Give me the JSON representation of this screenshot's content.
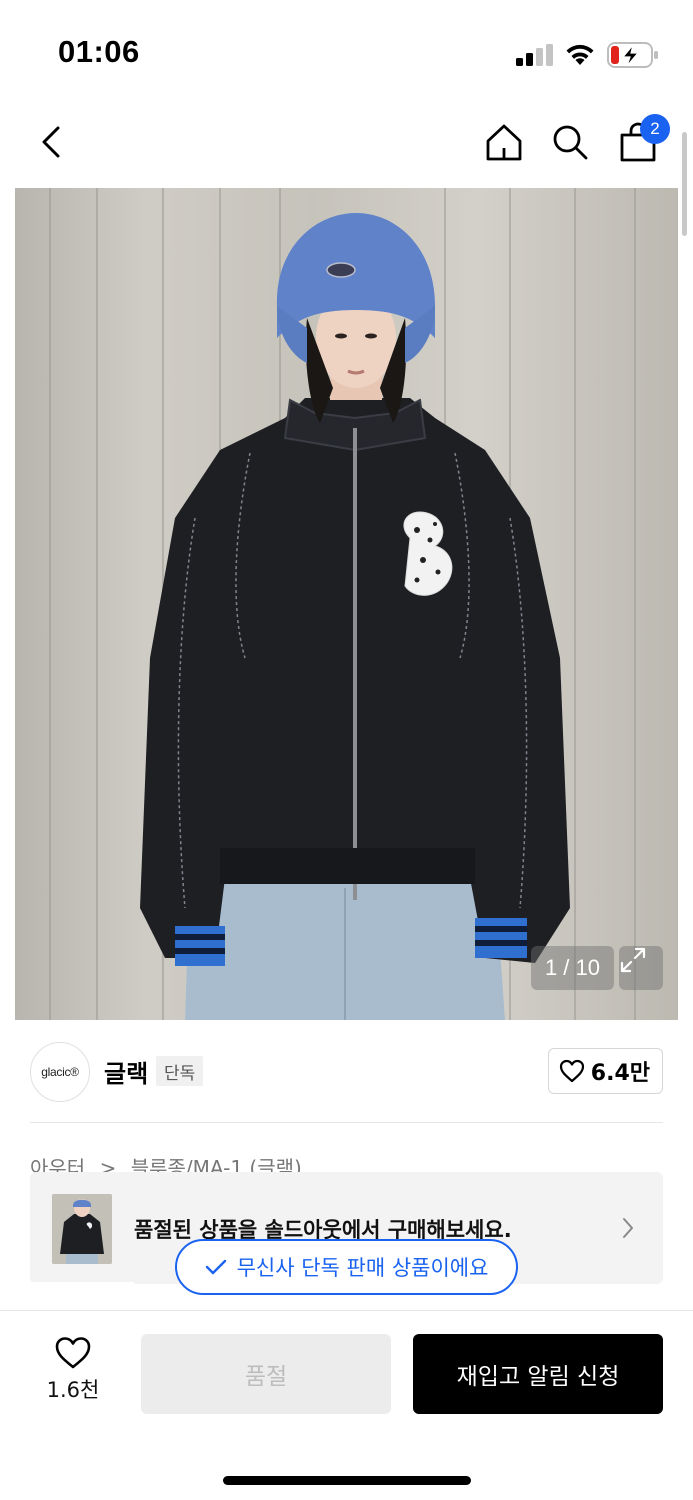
{
  "status_bar": {
    "time": "01:06"
  },
  "nav": {
    "cart_count": "2",
    "icons": [
      "back-chevron-icon",
      "home-icon",
      "search-icon",
      "shopping-bag-icon"
    ]
  },
  "product_image": {
    "counter": "1 / 10"
  },
  "brand": {
    "logo_text": "glacic®",
    "name": "글랙",
    "tag": "단독",
    "likes": "6.4만"
  },
  "breadcrumb": {
    "category": "아우터",
    "separator": ">",
    "subcategory": "블루종/MA-1 (글랙)"
  },
  "soldout_banner": {
    "text": "품절된 상품을 솔드아웃에서 구매해보세요."
  },
  "exclusive_pill": {
    "text": "무신사 단독 판매 상품이에요"
  },
  "bottom_bar": {
    "wish_count": "1.6천",
    "soldout_label": "품절",
    "restock_label": "재입고 알림 신청"
  },
  "colors": {
    "accent": "#1a63f0",
    "primary_button": "#000000",
    "disabled_button": "#ececec"
  }
}
